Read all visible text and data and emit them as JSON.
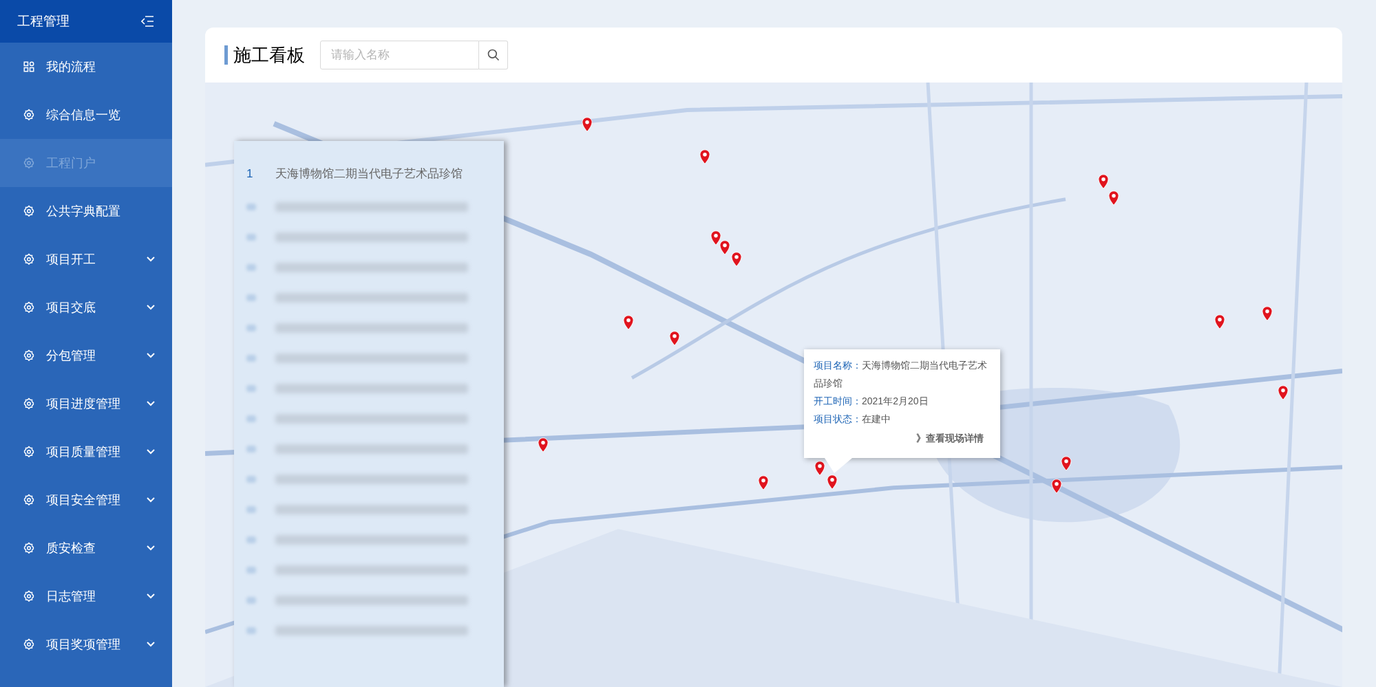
{
  "sidebar": {
    "title": "工程管理",
    "items": [
      {
        "label": "我的流程",
        "expandable": false,
        "selected": false
      },
      {
        "label": "综合信息一览",
        "expandable": false,
        "selected": false
      },
      {
        "label": "工程门户",
        "expandable": false,
        "selected": true
      },
      {
        "label": "公共字典配置",
        "expandable": false,
        "selected": false
      },
      {
        "label": "项目开工",
        "expandable": true,
        "selected": false
      },
      {
        "label": "项目交底",
        "expandable": true,
        "selected": false
      },
      {
        "label": "分包管理",
        "expandable": true,
        "selected": false
      },
      {
        "label": "项目进度管理",
        "expandable": true,
        "selected": false
      },
      {
        "label": "项目质量管理",
        "expandable": true,
        "selected": false
      },
      {
        "label": "项目安全管理",
        "expandable": true,
        "selected": false
      },
      {
        "label": "质安检查",
        "expandable": true,
        "selected": false
      },
      {
        "label": "日志管理",
        "expandable": true,
        "selected": false
      },
      {
        "label": "项目奖项管理",
        "expandable": true,
        "selected": false
      }
    ]
  },
  "board": {
    "title": "施工看板",
    "search": {
      "placeholder": "请输入名称"
    }
  },
  "project_list": [
    {
      "kind": "text",
      "index": "1",
      "name": "天海博物馆二期当代电子艺术品珍馆"
    },
    {
      "kind": "redacted"
    },
    {
      "kind": "redacted"
    },
    {
      "kind": "redacted"
    },
    {
      "kind": "redacted"
    },
    {
      "kind": "redacted"
    },
    {
      "kind": "redacted"
    },
    {
      "kind": "redacted"
    },
    {
      "kind": "redacted"
    },
    {
      "kind": "redacted"
    },
    {
      "kind": "redacted"
    },
    {
      "kind": "redacted"
    },
    {
      "kind": "redacted"
    },
    {
      "kind": "redacted"
    },
    {
      "kind": "redacted"
    },
    {
      "kind": "redacted"
    }
  ],
  "popup": {
    "fields": [
      {
        "label": "项目名称：",
        "value": "天海博物馆二期当代电子艺术品珍馆"
      },
      {
        "label": "开工时间：",
        "value": "2021年2月20日"
      },
      {
        "label": "项目状态：",
        "value": "在建中"
      }
    ],
    "link": "》查看现场详情"
  }
}
